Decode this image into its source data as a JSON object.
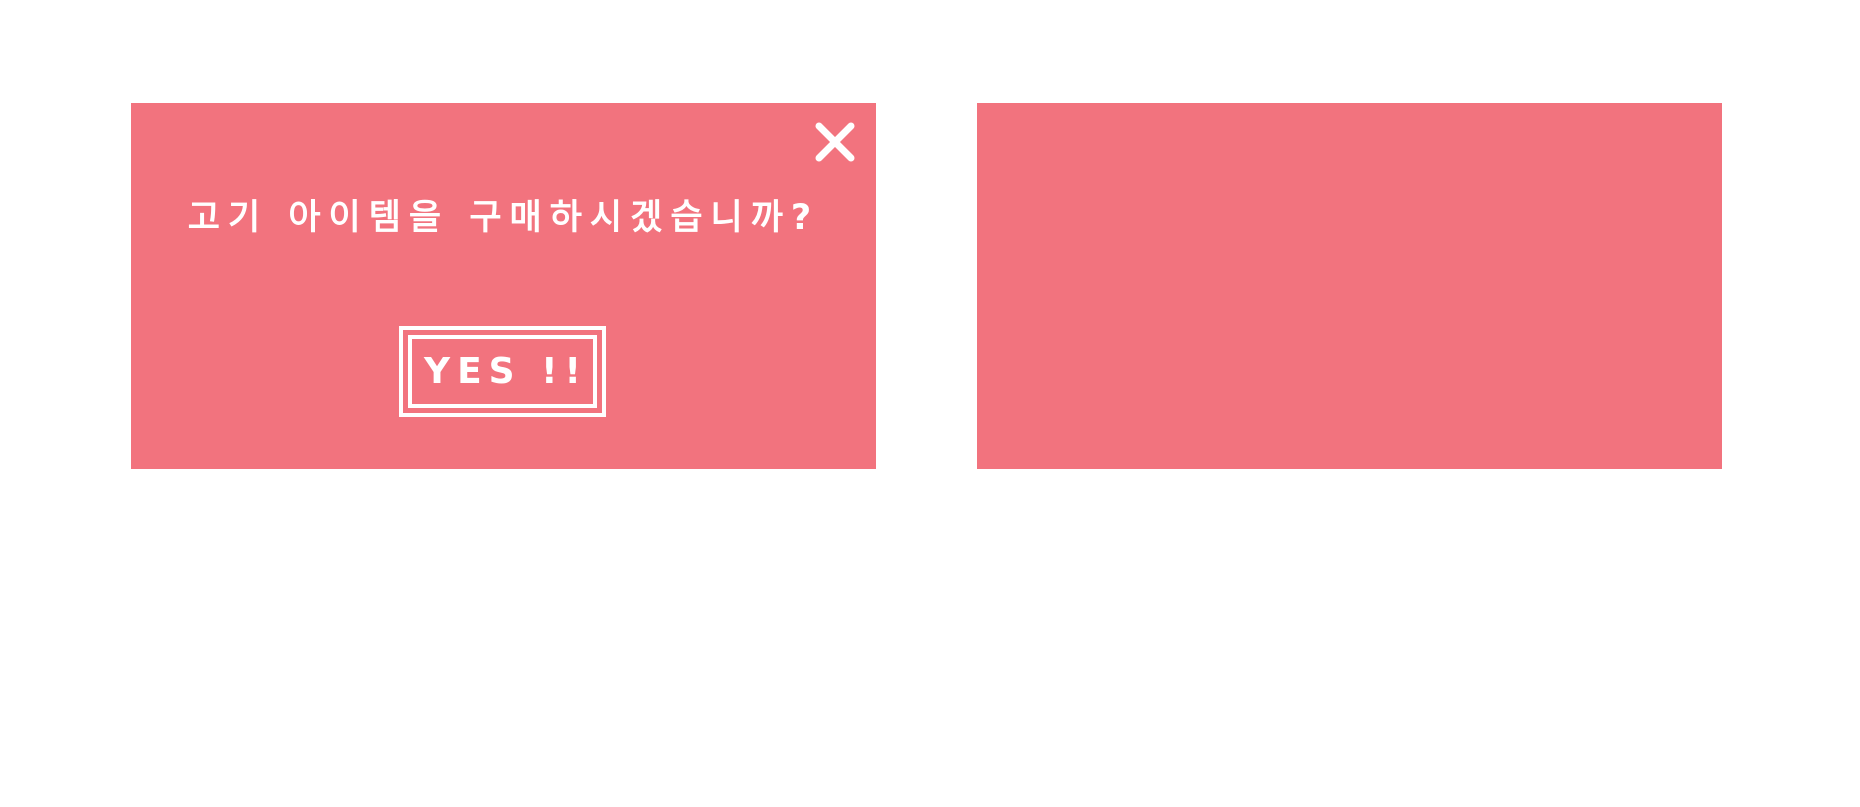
{
  "colors": {
    "panel": "#F2737E",
    "foreground": "#FFFFFF",
    "background": "#FFFFFF"
  },
  "dialog": {
    "message": "고기 아이템을 구매하시겠습니까?",
    "confirm_label": "YES !!",
    "close_icon": "close-icon"
  },
  "side_panel": {}
}
